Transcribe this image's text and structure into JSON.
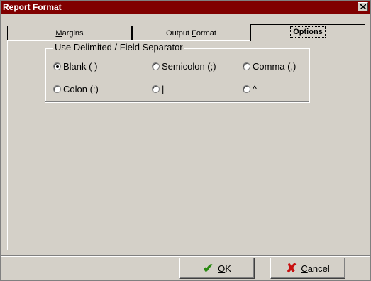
{
  "window": {
    "title": "Report Format",
    "close_glyph": "✕"
  },
  "tabs": [
    {
      "prefix": "",
      "accel": "M",
      "suffix": "argins",
      "active": false
    },
    {
      "prefix": "Output ",
      "accel": "F",
      "suffix": "ormat",
      "active": false
    },
    {
      "prefix": "",
      "accel": "O",
      "suffix": "ptions",
      "active": true
    }
  ],
  "options": {
    "group_label": "Use Delimited / Field Separator",
    "radios": [
      {
        "label": "Blank ( )",
        "checked": true
      },
      {
        "label": "Semicolon (;)",
        "checked": false
      },
      {
        "label": "Comma (,)",
        "checked": false
      },
      {
        "label": "Colon (:)",
        "checked": false
      },
      {
        "label": "|",
        "checked": false
      },
      {
        "label": "^",
        "checked": false
      }
    ]
  },
  "buttons": {
    "ok": {
      "accel": "O",
      "suffix": "K",
      "icon": "checkmark-icon",
      "icon_glyph": "✔",
      "icon_color": "#2a8a12"
    },
    "cancel": {
      "accel": "C",
      "suffix": "ancel",
      "icon": "x-icon",
      "icon_glyph": "✘",
      "icon_color": "#c81010"
    }
  },
  "colors": {
    "titlebar": "#800000",
    "face": "#d4d0c8"
  }
}
